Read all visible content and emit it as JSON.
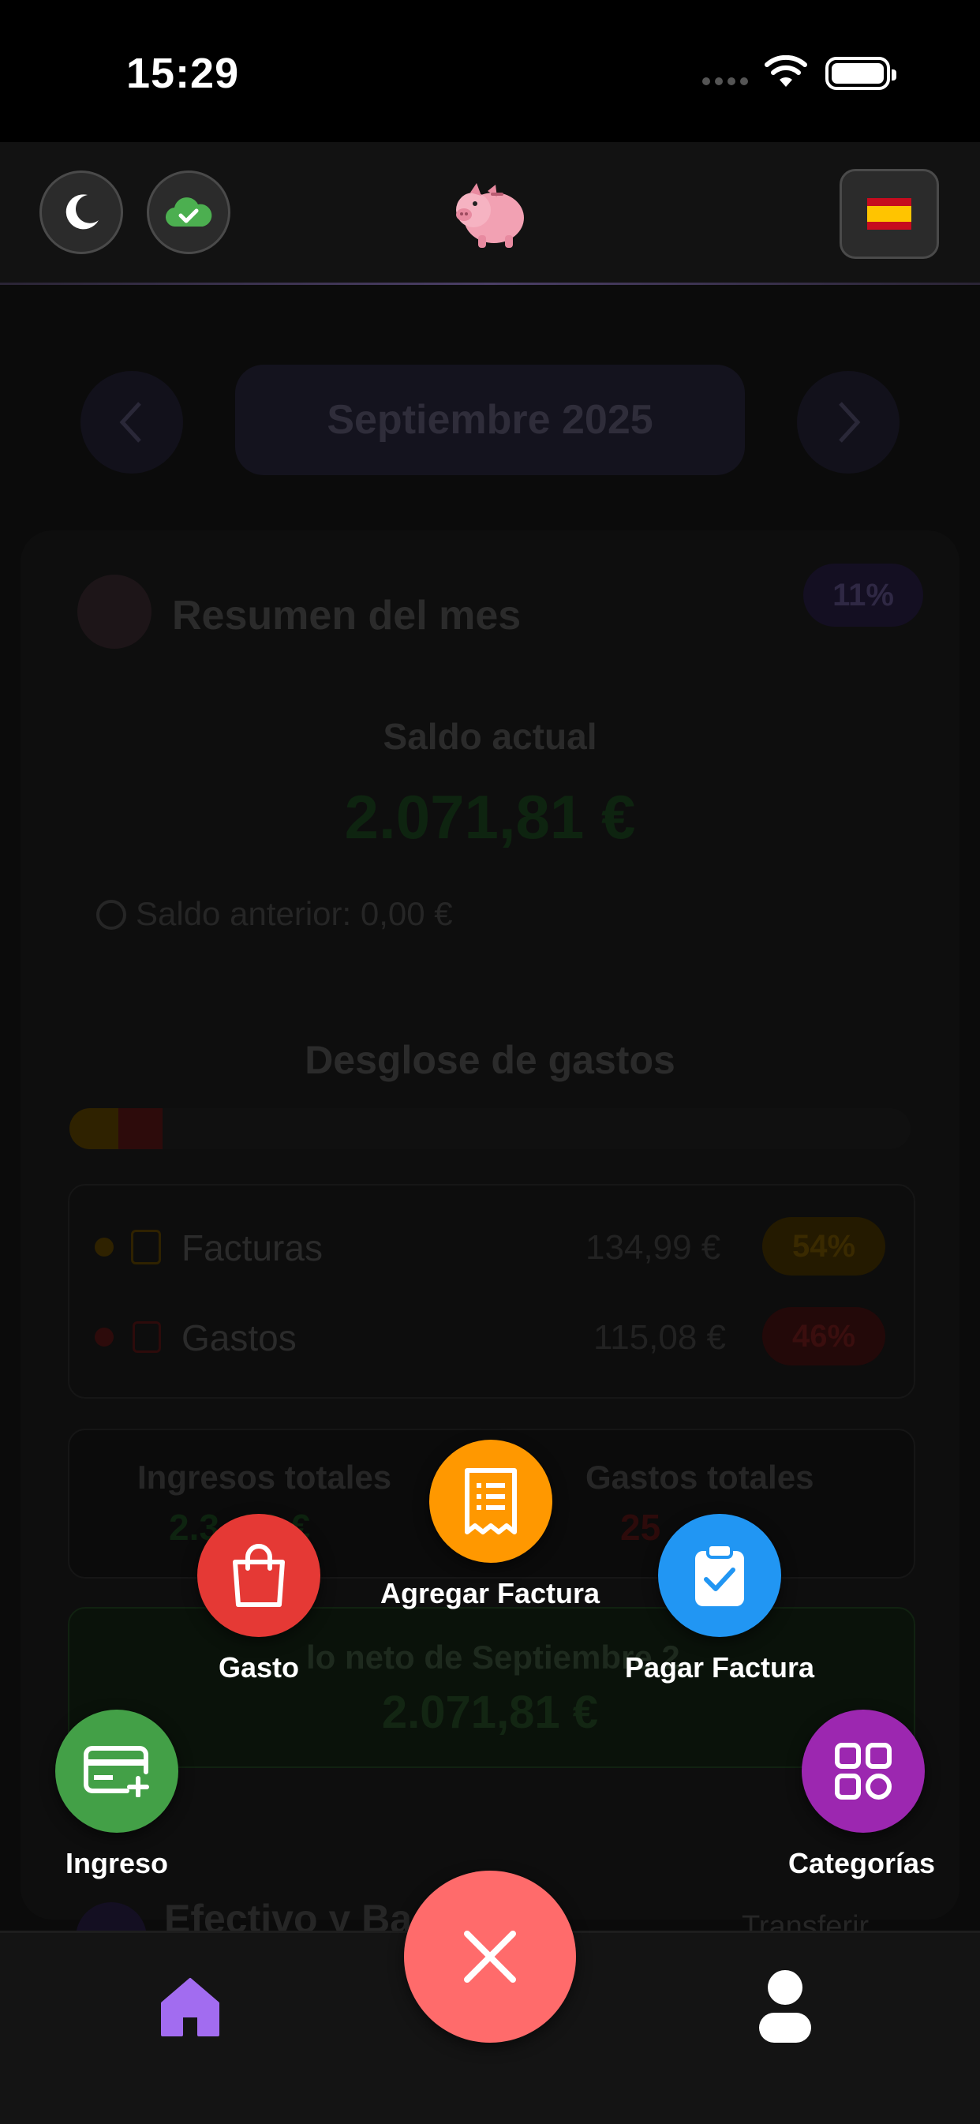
{
  "status_bar": {
    "time": "15:29"
  },
  "header": {
    "theme_icon": "moon-icon",
    "sync_icon": "cloud-check-icon",
    "logo_icon": "piggy-bank-icon",
    "language_icon": "spain-flag-icon"
  },
  "month_nav": {
    "month": "Septiembre 2025"
  },
  "summary": {
    "title": "Resumen del mes",
    "badge": "11%",
    "balance_label": "Saldo actual",
    "balance_value": "2.071,81 €",
    "previous_balance": "Saldo anterior: 0,00 €"
  },
  "breakdown": {
    "title": "Desglose de gastos",
    "rows": [
      {
        "label": "Facturas",
        "amount": "134,99 €",
        "percent": "54%",
        "color": "#f5a000"
      },
      {
        "label": "Gastos",
        "amount": "115,08 €",
        "percent": "46%",
        "color": "#e53935"
      }
    ]
  },
  "totals": {
    "income_label": "Ingresos totales",
    "income_value_partial": "2.3  88 €",
    "expenses_label": "Gastos totales",
    "expenses_value_partial": "25    €"
  },
  "net": {
    "label_partial": "lo neto de Septiembre 2",
    "value": "2.071,81 €"
  },
  "cash": {
    "label_partial": "Efectivo y Ba",
    "transfer_partial": "Transferir"
  },
  "quick_actions": {
    "add_bill": "Agregar Factura",
    "expense": "Gasto",
    "pay_bill": "Pagar Factura",
    "income": "Ingreso",
    "categories": "Categorías"
  },
  "colors": {
    "expense": "#e53935",
    "add_bill": "#ff9800",
    "pay_bill": "#2196f3",
    "income": "#43a047",
    "categories": "#9c27b0",
    "close": "#ff6b6b",
    "home_active": "#a26cf0"
  },
  "tabbar": {
    "home_icon": "home-icon",
    "profile_icon": "user-icon",
    "close_icon": "close-icon"
  }
}
